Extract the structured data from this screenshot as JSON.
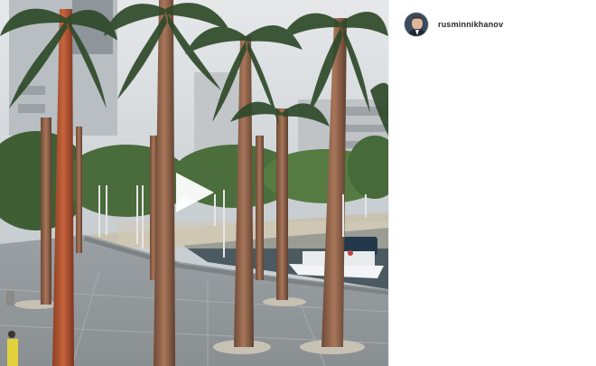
{
  "post": {
    "username": "rusminnikhanov"
  },
  "media": {
    "type": "video",
    "icons": {
      "play": "play-icon",
      "avatar": "user-avatar"
    }
  },
  "colors": {
    "background": "#ffffff",
    "username_text": "#262626",
    "play_overlay": "#ffffff"
  }
}
